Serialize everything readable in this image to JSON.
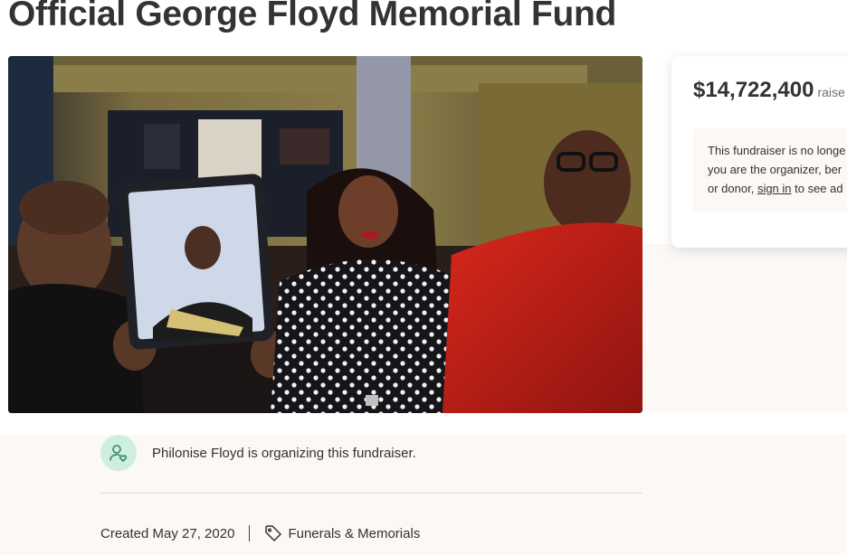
{
  "campaign": {
    "title": "Official George Floyd Memorial Fund",
    "photo_icon": "family-photo"
  },
  "donation_card": {
    "amount": "$14,722,400",
    "amount_suffix": "raise",
    "notice_line1": "This fundraiser is no longe",
    "notice_line2": "you are the organizer, ber",
    "notice_line3_prefix": "or donor, ",
    "sign_in_link": "sign in",
    "notice_line3_suffix": " to see ad"
  },
  "organizer": {
    "icon": "person-heart-icon",
    "text": "Philonise Floyd is organizing this fundraiser."
  },
  "meta": {
    "created": "Created May 27, 2020",
    "category_icon": "tag-icon",
    "category": "Funerals & Memorials"
  },
  "colors": {
    "title": "#333333",
    "accent_green": "#cdeee0",
    "cream": "#fbf8f6"
  }
}
